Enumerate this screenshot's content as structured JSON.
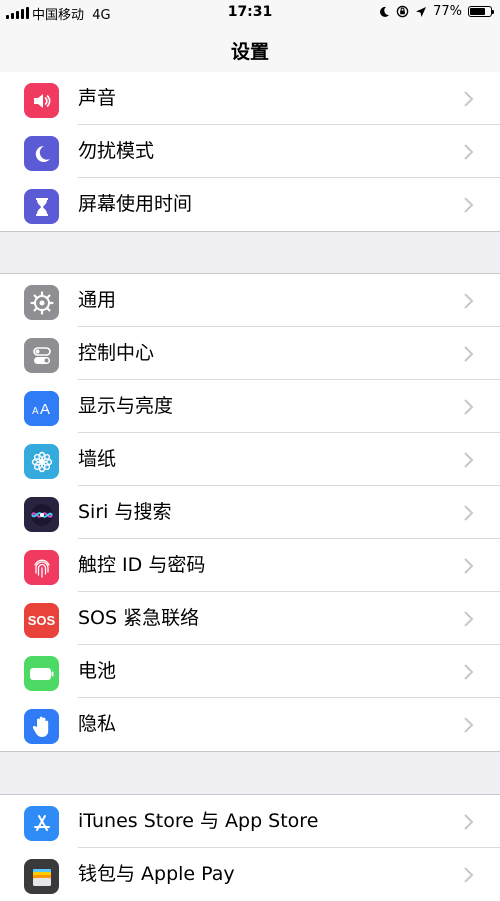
{
  "status": {
    "carrier": "中国移动",
    "network": "4G",
    "time": "17:31",
    "battery": "77%",
    "battery_level": 0.77
  },
  "nav": {
    "title": "设置"
  },
  "groups": [
    [
      {
        "label": "声音",
        "icon": "speaker-icon",
        "color": "#f03a5f"
      },
      {
        "label": "勿扰模式",
        "icon": "moon-icon",
        "color": "#5b5bd6"
      },
      {
        "label": "屏幕使用时间",
        "icon": "hourglass-icon",
        "color": "#5b5bd6"
      }
    ],
    [
      {
        "label": "通用",
        "icon": "gear-icon",
        "color": "#8e8e93"
      },
      {
        "label": "控制中心",
        "icon": "toggles-icon",
        "color": "#8e8e93"
      },
      {
        "label": "显示与亮度",
        "icon": "text-size-icon",
        "color": "#2f7cf6"
      },
      {
        "label": "墙纸",
        "icon": "flower-icon",
        "color": "#35aadc"
      },
      {
        "label": "Siri 与搜索",
        "icon": "siri-icon",
        "color": "#2a2340"
      },
      {
        "label": "触控 ID 与密码",
        "icon": "fingerprint-icon",
        "color": "#f03a5f"
      },
      {
        "label": "SOS 紧急联络",
        "icon": "sos-icon",
        "color": "#e8423b"
      },
      {
        "label": "电池",
        "icon": "battery-icon",
        "color": "#4cd964"
      },
      {
        "label": "隐私",
        "icon": "hand-icon",
        "color": "#2f7cf6"
      }
    ],
    [
      {
        "label": "iTunes Store 与 App Store",
        "icon": "app-store-icon",
        "color": "#2f8cf6"
      },
      {
        "label": "钱包与 Apple Pay",
        "icon": "wallet-icon",
        "color": "#3a3a3c"
      }
    ]
  ],
  "sos_text": "SOS"
}
